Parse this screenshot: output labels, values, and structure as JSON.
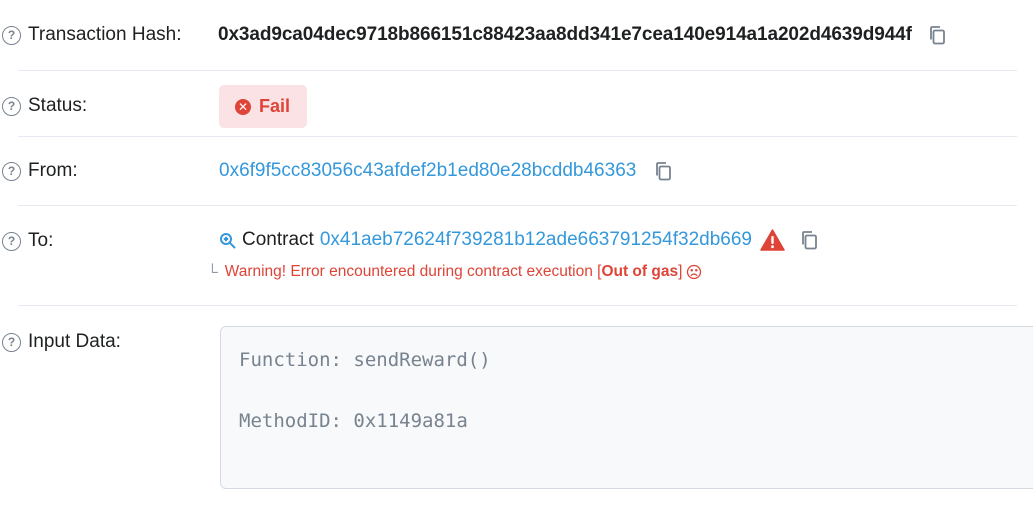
{
  "transaction_hash": {
    "label": "Transaction Hash:",
    "value": "0x3ad9ca04dec9718b866151c88423aa8dd341e7cea140e914a1a202d4639d944f"
  },
  "status": {
    "label": "Status:",
    "badge_text": "Fail",
    "badge_color": "#de4437",
    "badge_bg": "#fbe2e4"
  },
  "from": {
    "label": "From:",
    "address": "0x6f9f5cc83056c43afdef2b1ed80e28bcddb46363"
  },
  "to": {
    "label": "To:",
    "contract_word": "Contract",
    "address": "0x41aeb72624f739281b12ade663791254f32db669",
    "warning_prefix": "Warning! Error encountered during contract execution [",
    "warning_reason": "Out of gas",
    "warning_suffix": "]"
  },
  "input_data": {
    "label": "Input Data:",
    "function_line": "Function: sendReward()",
    "method_line": "MethodID: 0x1149a81a"
  },
  "help_symbol": "?",
  "colors": {
    "link": "#3498db",
    "error": "#de4437",
    "text": "#1e2022",
    "muted": "#77838f"
  },
  "icons": [
    "help-icon",
    "copy-icon",
    "fail-icon",
    "zoom-icon",
    "warning-icon",
    "sad-face-icon"
  ]
}
